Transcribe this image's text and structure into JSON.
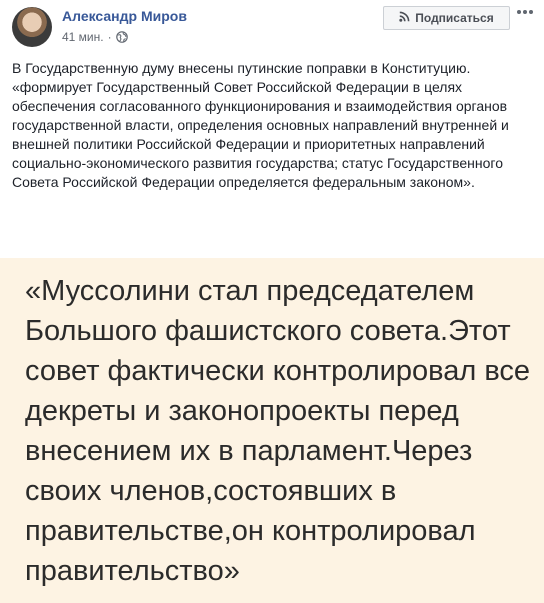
{
  "post": {
    "author": "Александр Миров",
    "time": "41 мин.",
    "separator": "·",
    "subscribe_label": "Подписаться",
    "privacy_icon": "globe-icon",
    "text_p1": "В Государственную думу внесены путинские поправки в Конституцию.",
    "text_p2": "«формирует Государственный Совет Российской Федерации в целях обеспечения согласованного функционирования и взаимодействия органов государственной власти, определения основных направлений внутренней и внешней политики Российской Федерации и приоритетных направлений социально-экономического развития государства; статус Государственного Совета Российской Федерации определяется федеральным законом»."
  },
  "quote": {
    "text": "«Муссолини стал председателем Большого фашистского совета.Этот совет фактически контролировал все декреты и законопроекты перед внесением их в парламент.Через своих членов,состоявших в правительстве,он контролировал правительство»",
    "background": "#fdf3e3"
  },
  "colors": {
    "author_link": "#385898",
    "text": "#1d2129",
    "meta": "#616770"
  }
}
